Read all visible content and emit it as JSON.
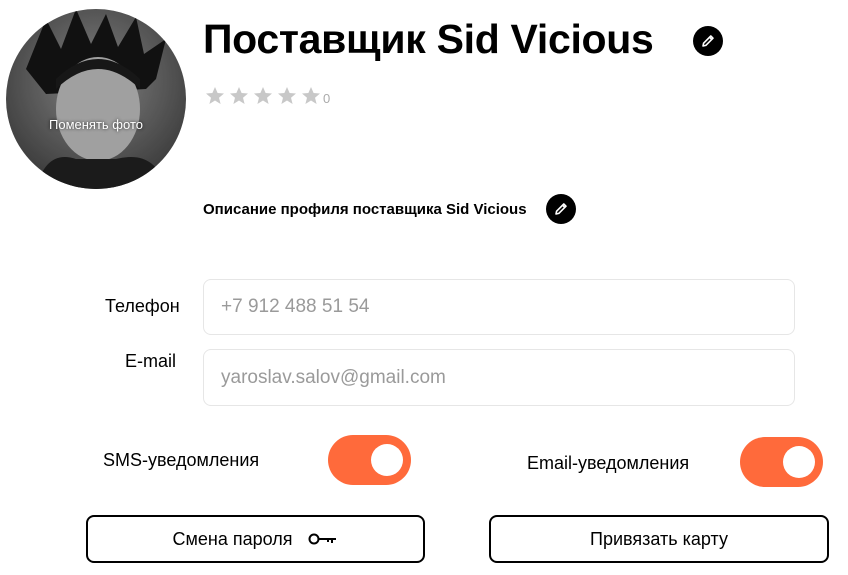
{
  "profile": {
    "title": "Поставщик Sid Vicious",
    "change_photo_label": "Поменять фото",
    "description": "Описание профиля поставщика Sid Vicious",
    "rating": {
      "stars": 5,
      "filled": 0,
      "count": "0",
      "star_color": "#c8c8c8"
    }
  },
  "form": {
    "phone_label": "Телефон",
    "phone_value": "+7 912 488 51 54",
    "email_label": "E-mail",
    "email_value": "yaroslav.salov@gmail.com"
  },
  "notifications": {
    "sms_label": "SMS-уведомления",
    "sms_on": true,
    "email_label": "Email-уведомления",
    "email_on": true,
    "toggle_color": "#ff6a3b"
  },
  "buttons": {
    "change_password": "Смена пароля",
    "link_card": "Привязать карту"
  },
  "icons": {
    "edit": "pencil-icon",
    "key": "key-icon",
    "star": "star-icon"
  }
}
